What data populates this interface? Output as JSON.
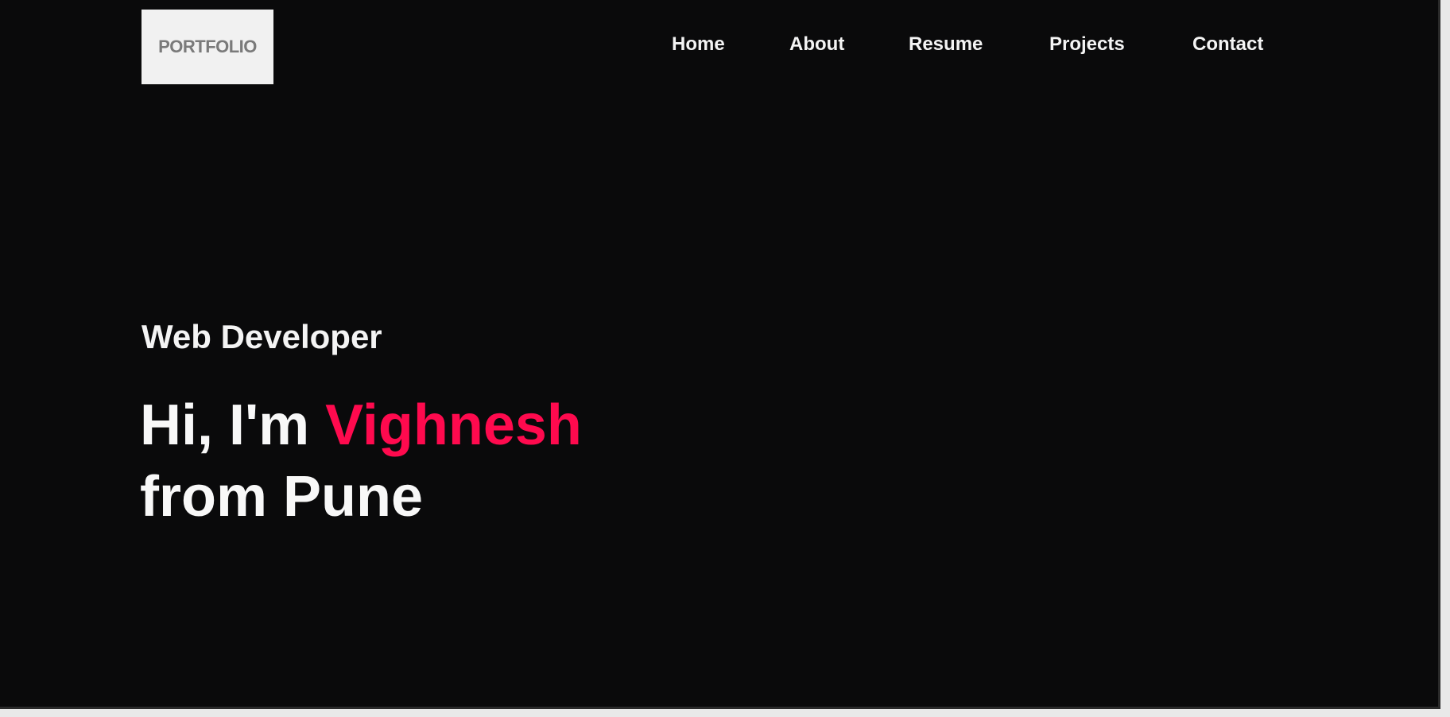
{
  "header": {
    "logo_text": "PORTFOLIO",
    "nav": [
      {
        "label": "Home"
      },
      {
        "label": "About"
      },
      {
        "label": "Resume"
      },
      {
        "label": "Projects"
      },
      {
        "label": "Contact"
      }
    ]
  },
  "hero": {
    "subtitle": "Web Developer",
    "greeting": "Hi, I'm",
    "name": "Vighnesh",
    "location_line": "from Pune"
  },
  "colors": {
    "background": "#0a0a0b",
    "text": "#f4f4f4",
    "accent": "#ff0a4e",
    "logo_background": "#f1f1f1"
  }
}
